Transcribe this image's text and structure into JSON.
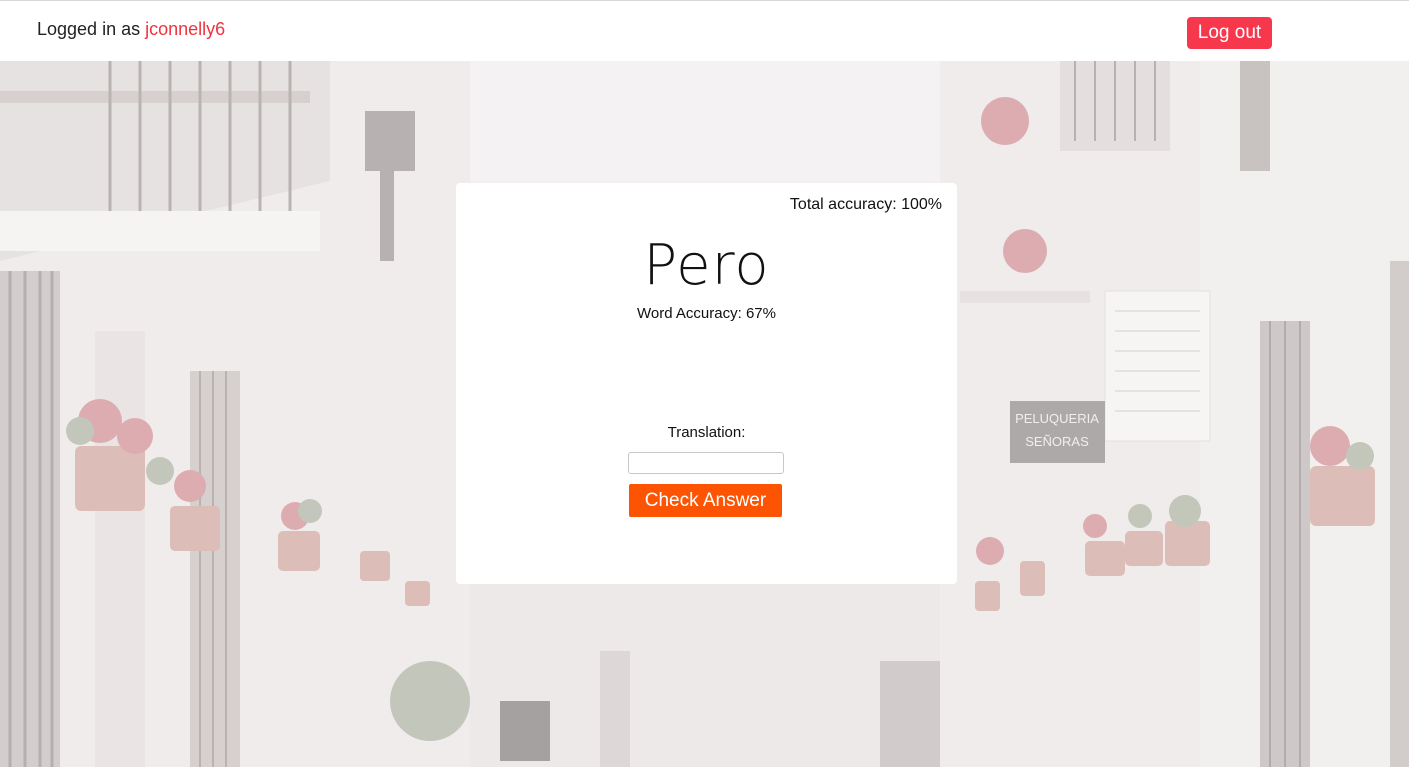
{
  "header": {
    "logged_in_prefix": "Logged in as ",
    "username": "jconnelly6",
    "logout_label": "Log out"
  },
  "card": {
    "total_accuracy": "Total accuracy: 100%",
    "word": "Pero",
    "word_accuracy": "Word Accuracy: 67%",
    "translation_label": "Translation:",
    "translation_value": "",
    "check_label": "Check Answer"
  },
  "background": {
    "description_icon": "street-scene-image",
    "shop_sign": "PELUQUERIA SEÑORAS"
  },
  "colors": {
    "accent_red": "#f7374c",
    "username_red": "#f0323e",
    "check_orange": "#fd5404"
  }
}
